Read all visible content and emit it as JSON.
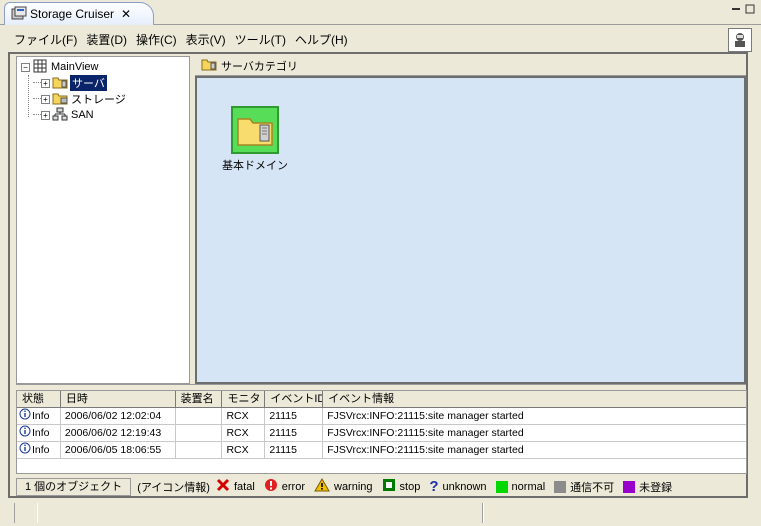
{
  "window": {
    "tab_title": "Storage Cruiser",
    "tab_close": "✕",
    "minimize": "▭",
    "maximize": "☐"
  },
  "menu": {
    "items": [
      "ファイル(F)",
      "装置(D)",
      "操作(C)",
      "表示(V)",
      "ツール(T)",
      "ヘルプ(H)"
    ]
  },
  "tree": {
    "root": "MainView",
    "children": [
      "サーバ",
      "ストレージ",
      "SAN"
    ],
    "selected": "サーバ"
  },
  "content": {
    "header": "サーバカテゴリ",
    "items": [
      {
        "label": "基本ドメイン",
        "status_color": "#58dd58"
      }
    ]
  },
  "events": {
    "columns": [
      "状態",
      "日時",
      "装置名",
      "モニタ",
      "イベントID",
      "イベント情報"
    ],
    "rows": [
      {
        "status": "Info",
        "datetime": "2006/06/02 12:02:04",
        "device": "",
        "monitor": "RCX",
        "event_id": "21115",
        "info": "FJSVrcx:INFO:21115:site manager started"
      },
      {
        "status": "Info",
        "datetime": "2006/06/02 12:19:43",
        "device": "",
        "monitor": "RCX",
        "event_id": "21115",
        "info": "FJSVrcx:INFO:21115:site manager started"
      },
      {
        "status": "Info",
        "datetime": "2006/06/05 18:06:55",
        "device": "",
        "monitor": "RCX",
        "event_id": "21115",
        "info": "FJSVrcx:INFO:21115:site manager started"
      }
    ]
  },
  "legend": {
    "object_count": "1 個のオブジェクト",
    "icon_info_label": "(アイコン情報)",
    "fatal": "fatal",
    "error": "error",
    "warning": "warning",
    "stop": "stop",
    "unknown": "unknown",
    "normal": "normal",
    "comm_error": "通信不可",
    "unregistered": "未登録",
    "colors": {
      "normal": "#00d800",
      "comm_error": "#8c8c8c",
      "unregistered": "#9900cc",
      "fatal": "#d40000",
      "error": "#e02020",
      "warning": "#f0c000",
      "stop": "#007a00",
      "unknown": "#1a2fa8"
    }
  }
}
